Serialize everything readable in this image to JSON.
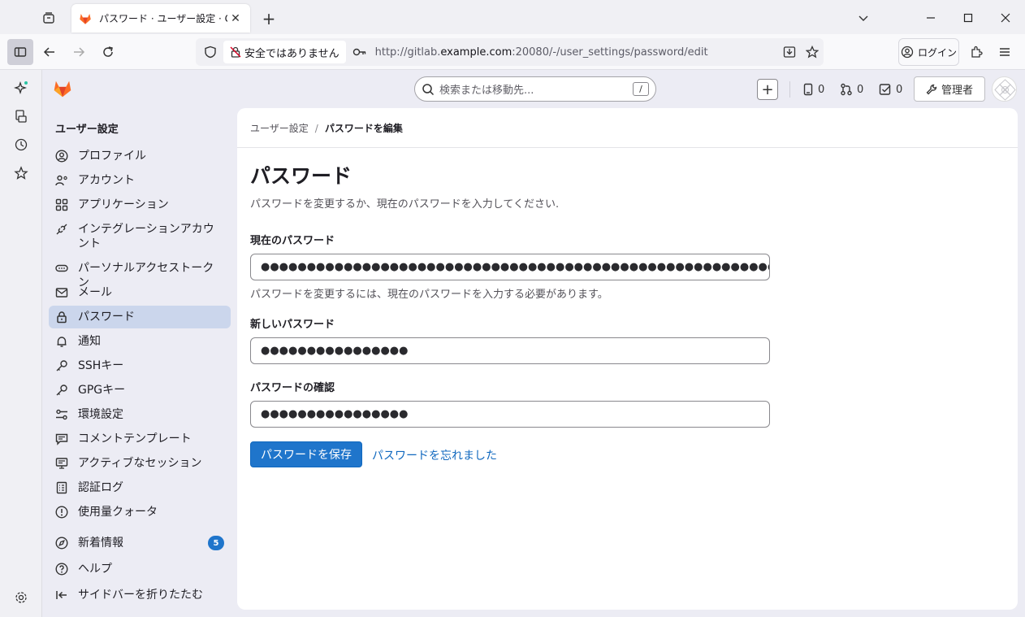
{
  "browser": {
    "tab_title": "パスワード · ユーザー設定 · GitLab",
    "insecure_label": "安全ではありません",
    "url_prefix": "http://gitlab.",
    "url_host": "example.com",
    "url_suffix": ":20080/-/user_settings/password/edit",
    "login_label": "ログイン"
  },
  "gitlab": {
    "search_placeholder": "検索または移動先...",
    "search_shortcut": "/",
    "counts": {
      "issues": "0",
      "merge_requests": "0",
      "todos": "0"
    },
    "admin_label": "管理者",
    "brand_color": "#e24329"
  },
  "sidebar": {
    "section_title": "ユーザー設定",
    "items": [
      {
        "label": "プロファイル",
        "icon": "profile-icon"
      },
      {
        "label": "アカウント",
        "icon": "account-icon"
      },
      {
        "label": "アプリケーション",
        "icon": "applications-icon"
      },
      {
        "label": "インテグレーションアカウント",
        "icon": "integrations-icon"
      },
      {
        "label": "パーソナルアクセストークン",
        "icon": "token-icon"
      },
      {
        "label": "メール",
        "icon": "mail-icon"
      },
      {
        "label": "パスワード",
        "icon": "lock-icon",
        "active": true
      },
      {
        "label": "通知",
        "icon": "bell-icon"
      },
      {
        "label": "SSHキー",
        "icon": "key-icon"
      },
      {
        "label": "GPGキー",
        "icon": "key-icon"
      },
      {
        "label": "環境設定",
        "icon": "preferences-icon"
      },
      {
        "label": "コメントテンプレート",
        "icon": "comment-icon"
      },
      {
        "label": "アクティブなセッション",
        "icon": "monitor-icon"
      },
      {
        "label": "認証ログ",
        "icon": "log-icon"
      },
      {
        "label": "使用量クォータ",
        "icon": "quota-icon"
      }
    ],
    "whats_new": {
      "label": "新着情報",
      "badge": "5"
    },
    "help_label": "ヘルプ",
    "collapse_label": "サイドバーを折りたたむ"
  },
  "page": {
    "breadcrumb_root": "ユーザー設定",
    "breadcrumb_current": "パスワードを編集",
    "title": "パスワード",
    "subtitle": "パスワードを変更するか、現在のパスワードを入力してください.",
    "current_label": "現在のパスワード",
    "current_value": "●●●●●●●●●●●●●●●●●●●●●●●●●●●●●●●●●●●●●●●●●●●●●●●●●●●●●●●●●●●●●●●●●●●●●●●●●●●●●●●",
    "current_help": "パスワードを変更するには、現在のパスワードを入力する必要があります。",
    "new_label": "新しいパスワード",
    "new_value": "●●●●●●●●●●●●●●●●",
    "confirm_label": "パスワードの確認",
    "confirm_value": "●●●●●●●●●●●●●●●●",
    "save_label": "パスワードを保存",
    "forgot_label": "パスワードを忘れました"
  }
}
